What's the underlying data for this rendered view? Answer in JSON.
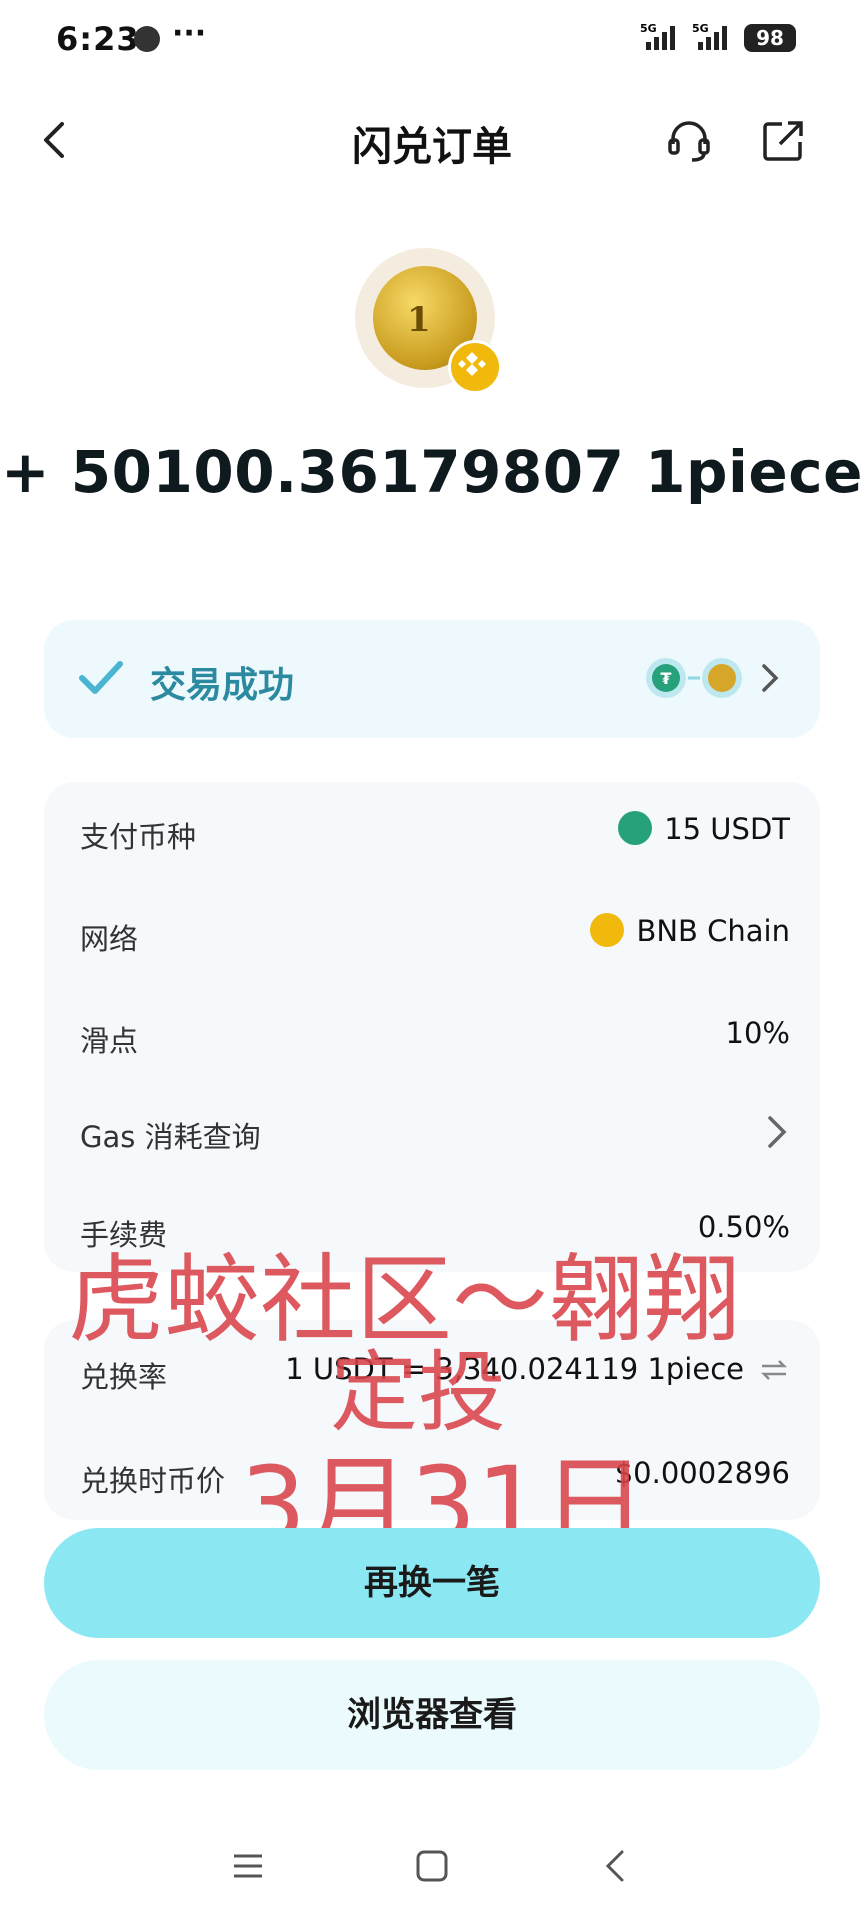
{
  "status_bar": {
    "time": "6:23",
    "more": "···",
    "network_1": "5G",
    "network_2": "5G",
    "battery": "98"
  },
  "header": {
    "title": "闪兑订单",
    "back_icon": "chevron-left-icon",
    "support_icon": "headset-icon",
    "share_icon": "share-icon"
  },
  "token": {
    "coin_text": "1",
    "chain_badge_icon": "bnb-icon",
    "amount": "+ 50100.36179807 1piece"
  },
  "status_card": {
    "label": "交易成功",
    "check_icon": "check-icon",
    "pair_icons": [
      "usdt-icon",
      "1piece-icon"
    ],
    "chevron_icon": "chevron-right-icon"
  },
  "details": {
    "pay_currency": {
      "label": "支付币种",
      "value": "15 USDT",
      "icon": "usdt-icon"
    },
    "network": {
      "label": "网络",
      "value": "BNB Chain",
      "icon": "bnb-icon"
    },
    "slippage": {
      "label": "滑点",
      "value": "10%"
    },
    "gas": {
      "label": "Gas 消耗查询",
      "icon": "chevron-right-icon"
    },
    "fee": {
      "label": "手续费",
      "value": "0.50%"
    },
    "rate": {
      "label": "兑换率",
      "value": "1 USDT = 3,340.024119 1piece",
      "icon": "swap-icon"
    },
    "price": {
      "label": "兑换时币价",
      "value": "$0.0002896"
    }
  },
  "watermark": {
    "line1": "虎蛟社区～翱翔",
    "line2": "定投",
    "line3": "3月31日"
  },
  "buttons": {
    "swap_again": "再换一笔",
    "view_browser": "浏览器查看"
  },
  "nav": {
    "menu_icon": "menu-icon",
    "home_icon": "home-icon",
    "back_icon": "back-icon"
  },
  "colors": {
    "accent": "#8be8f2",
    "success_text": "#2b8aa0",
    "watermark": "#d9434a",
    "usdt": "#26a17b",
    "bnb": "#f0b90b"
  }
}
